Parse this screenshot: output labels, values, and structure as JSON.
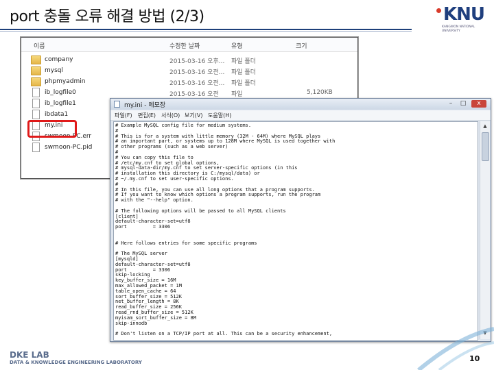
{
  "slide": {
    "title": "port 충돌 오류 해결 방법 (2/3)",
    "page_number": "10",
    "footer_lab": "DKE LAB",
    "footer_sub": "DATA & KNOWLEDGE ENGINEERING LABORATORY",
    "logo_text": "KNU",
    "logo_sub": "KANGWON NATIONAL UNIVERSITY"
  },
  "explorer": {
    "columns": [
      "이름",
      "수정한 날짜",
      "유형",
      "크기"
    ],
    "rows": [
      {
        "name": "company",
        "date": "2015-03-16 오후...",
        "type": "파일 폴더",
        "size": "",
        "kind": "folder"
      },
      {
        "name": "mysql",
        "date": "2015-03-16 오전...",
        "type": "파일 폴더",
        "size": "",
        "kind": "folder"
      },
      {
        "name": "phpmyadmin",
        "date": "2015-03-16 오전...",
        "type": "파일 폴더",
        "size": "",
        "kind": "folder"
      },
      {
        "name": "ib_logfile0",
        "date": "2015-03-16 오전",
        "type": "파일",
        "size": "5,120KB",
        "kind": "file"
      },
      {
        "name": "ib_logfile1",
        "date": "",
        "type": "",
        "size": "",
        "kind": "file"
      },
      {
        "name": "ibdata1",
        "date": "",
        "type": "",
        "size": "",
        "kind": "file"
      },
      {
        "name": "my.ini",
        "date": "",
        "type": "",
        "size": "",
        "kind": "file"
      },
      {
        "name": "swmoon-PC.err",
        "date": "",
        "type": "",
        "size": "",
        "kind": "file"
      },
      {
        "name": "swmoon-PC.pid",
        "date": "",
        "type": "",
        "size": "",
        "kind": "file"
      }
    ]
  },
  "notepad": {
    "title": "my.ini - 메모장",
    "menus": [
      "파일(F)",
      "편집(E)",
      "서식(O)",
      "보기(V)",
      "도움말(H)"
    ],
    "controls": {
      "minimize": "–",
      "maximize": "□",
      "close": "x"
    },
    "lines": [
      "# Example MySQL config file for medium systems.",
      "#",
      "# This is for a system with little memory (32M - 64M) where MySQL plays",
      "# an important part, or systems up to 128M where MySQL is used together with",
      "# other programs (such as a web server)",
      "#",
      "# You can copy this file to",
      "# /etc/my.cnf to set global options,",
      "# mysql-data-dir/my.cnf to set server-specific options (in this",
      "# installation this directory is C:/mysql/data) or",
      "# ~/.my.cnf to set user-specific options.",
      "#",
      "# In this file, you can use all long options that a program supports.",
      "# If you want to know which options a program supports, run the program",
      "# with the \"--help\" option.",
      "",
      "# The following options will be passed to all MySQL clients",
      "[client]",
      "default-character-set=utf8",
      "port         = 3306",
      "",
      "",
      "# Here follows entries for some specific programs",
      "",
      "# The MySQL server",
      "[mysqld]",
      "default-character-set=utf8",
      "port         = 3306",
      "skip-locking",
      "key_buffer_size = 16M",
      "max_allowed_packet = 1M",
      "table_open_cache = 64",
      "sort_buffer_size = 512K",
      "net_buffer_length = 8K",
      "read_buffer_size = 256K",
      "read_rnd_buffer_size = 512K",
      "myisam_sort_buffer_size = 8M",
      "skip-innodb",
      "",
      "# Don't listen on a TCP/IP port at all. This can be a security enhancement,"
    ]
  }
}
